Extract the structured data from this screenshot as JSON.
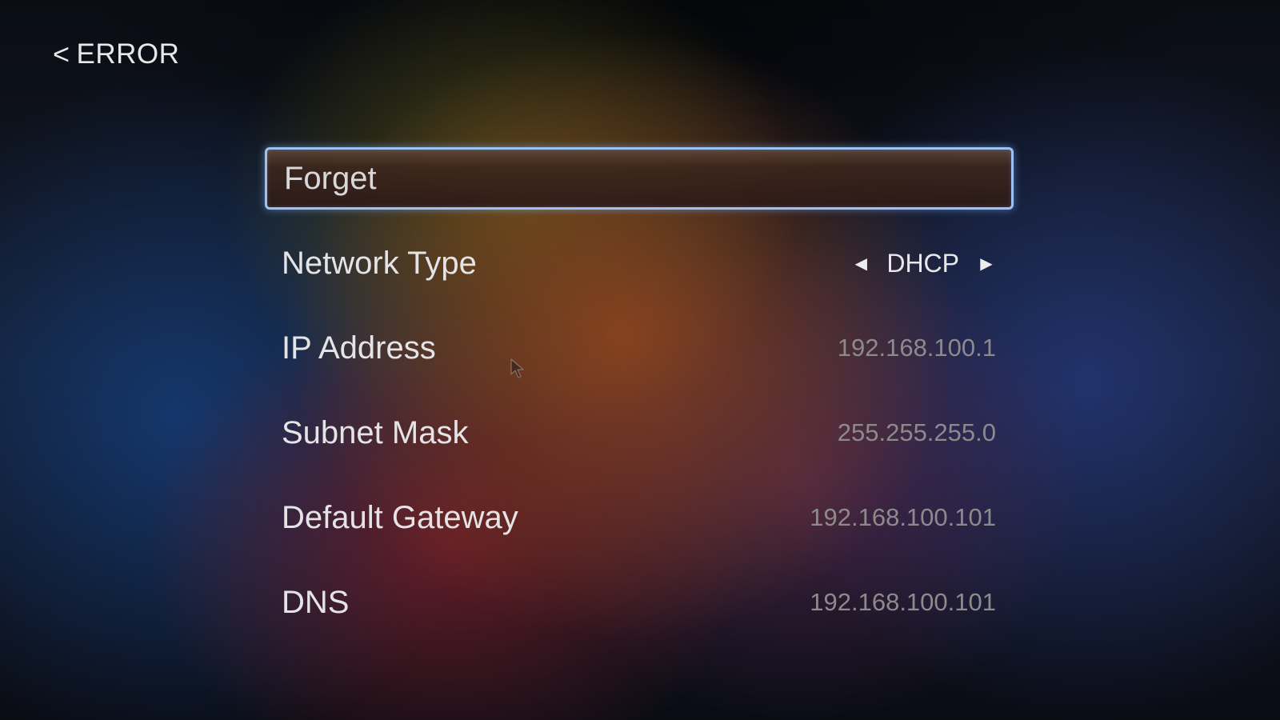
{
  "header": {
    "back_chevron": "<",
    "title": "ERROR"
  },
  "menu": {
    "forget": {
      "label": "Forget"
    },
    "network_type": {
      "label": "Network Type",
      "value": "DHCP",
      "prev_glyph": "◀",
      "next_glyph": "▶"
    },
    "ip_address": {
      "label": "IP Address",
      "value": "192.168.100.1"
    },
    "subnet_mask": {
      "label": "Subnet Mask",
      "value": "255.255.255.0"
    },
    "default_gateway": {
      "label": "Default Gateway",
      "value": "192.168.100.101"
    },
    "dns": {
      "label": "DNS",
      "value": "192.168.100.101"
    }
  },
  "colors": {
    "focus_border": "#9cc2f3",
    "label_text": "#e4e4e6",
    "value_text": "#8e8a8c"
  },
  "icons": {
    "back": "chevron-left-icon",
    "prev": "triangle-left-icon",
    "next": "triangle-right-icon",
    "pointer": "mouse-pointer-icon"
  }
}
